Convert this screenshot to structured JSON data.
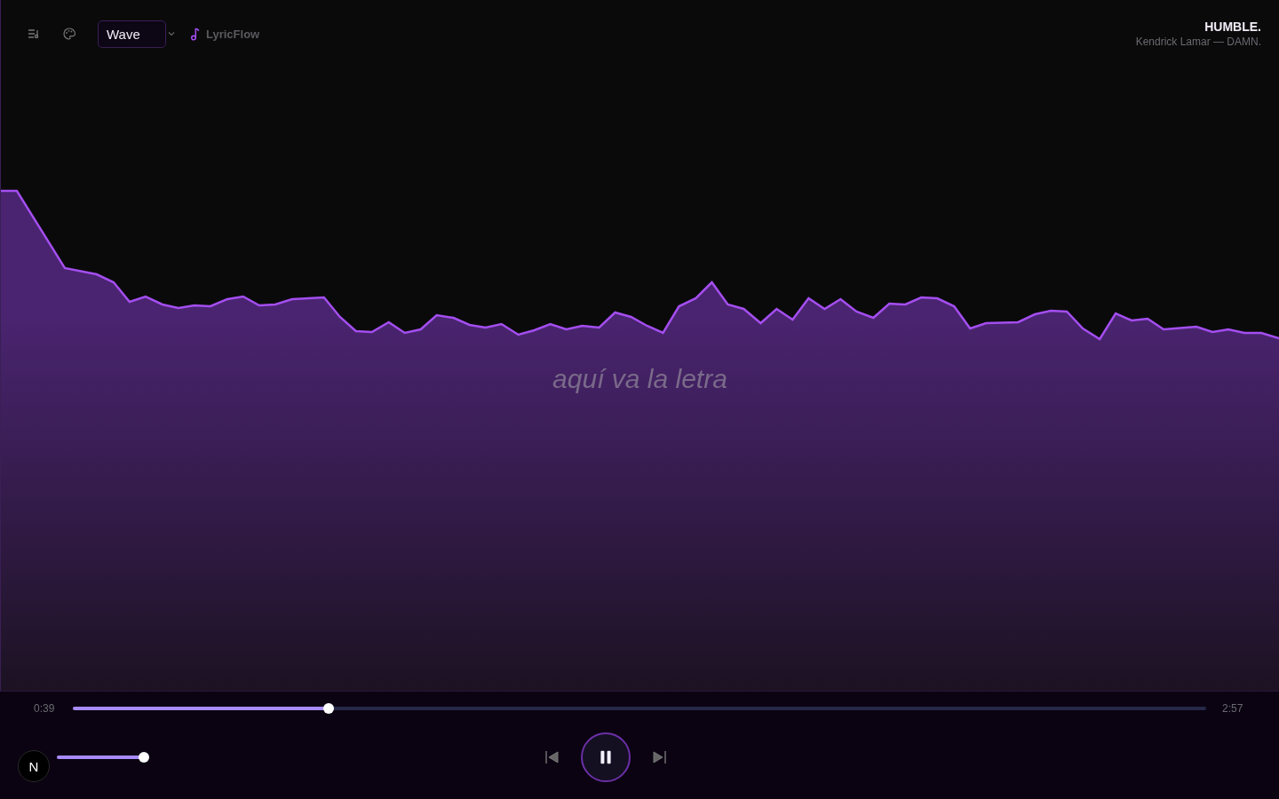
{
  "toolbar": {
    "mode_select": {
      "value": "Wave"
    },
    "brand": "LyricFlow"
  },
  "track": {
    "title": "HUMBLE.",
    "subtitle": "Kendrick Lamar — DAMN."
  },
  "lyric": "aquí va la letra",
  "player": {
    "elapsed": "0:39",
    "duration": "2:57",
    "progress": {
      "level": 0.226
    },
    "volume": {
      "level": 1.0
    },
    "playing": true
  },
  "dev_badge": "N"
}
